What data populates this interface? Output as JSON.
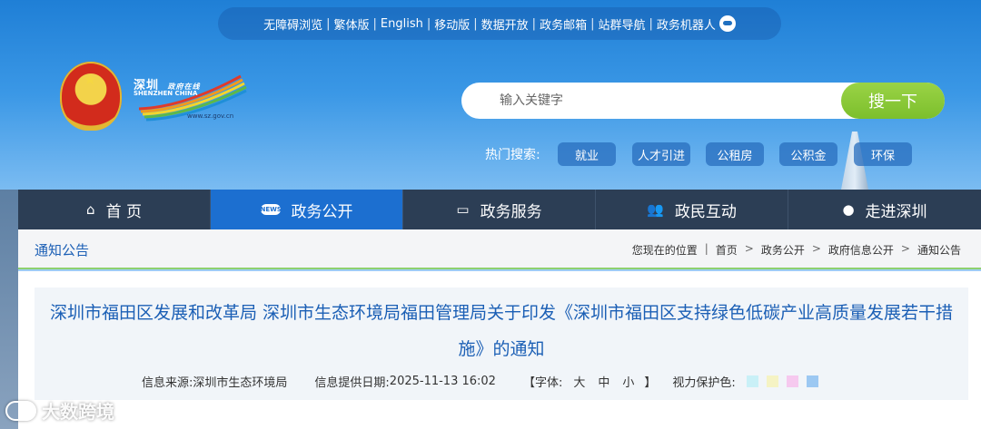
{
  "topbar": {
    "links": [
      "无障碍浏览",
      "繁体版",
      "English",
      "移动版",
      "数据开放",
      "政务邮箱",
      "站群导航",
      "政务机器人"
    ]
  },
  "logo": {
    "title": "深圳",
    "title_small": "政府在线",
    "subtitle": "SHENZHEN CHINA",
    "url": "www.sz.gov.cn"
  },
  "search": {
    "placeholder": "输入关键字",
    "button_label": "搜一下"
  },
  "hot": {
    "label": "热门搜索:",
    "tags": [
      "就业",
      "人才引进",
      "公租房",
      "公积金",
      "环保"
    ]
  },
  "nav": {
    "items": [
      {
        "label": "首 页",
        "icon": "home-icon"
      },
      {
        "label": "政务公开",
        "icon": "news-icon"
      },
      {
        "label": "政务服务",
        "icon": "monitor-icon"
      },
      {
        "label": "政民互动",
        "icon": "users-icon"
      },
      {
        "label": "走进深圳",
        "icon": "info-icon"
      }
    ],
    "active_index": 1
  },
  "section": {
    "title": "通知公告"
  },
  "breadcrumb": {
    "prefix": "您现在的位置",
    "items": [
      "首页",
      "政务公开",
      "政府信息公开",
      "通知公告"
    ]
  },
  "article": {
    "title": "深圳市福田区发展和改革局 深圳市生态环境局福田管理局关于印发《深圳市福田区支持绿色低碳产业高质量发展若干措施》的通知",
    "source_label": "信息来源:",
    "source": "深圳市生态环境局",
    "date_label": "信息提供日期:",
    "date": "2025-11-13 16:02",
    "font_label": "【字体:",
    "font_large": "大",
    "font_medium": "中",
    "font_small": "小",
    "font_close": "】",
    "eye_label": "视力保护色:",
    "eye_colors": [
      "#c9f0f7",
      "#f5f3c4",
      "#f6c9ef",
      "#9cc8f2"
    ]
  },
  "watermark": "大数跨境",
  "colors": {
    "nav_bg": "#2c3e55",
    "nav_active": "#1c6fd0",
    "search_button": "#8ccb3a",
    "title_blue": "#1b5fb5"
  }
}
